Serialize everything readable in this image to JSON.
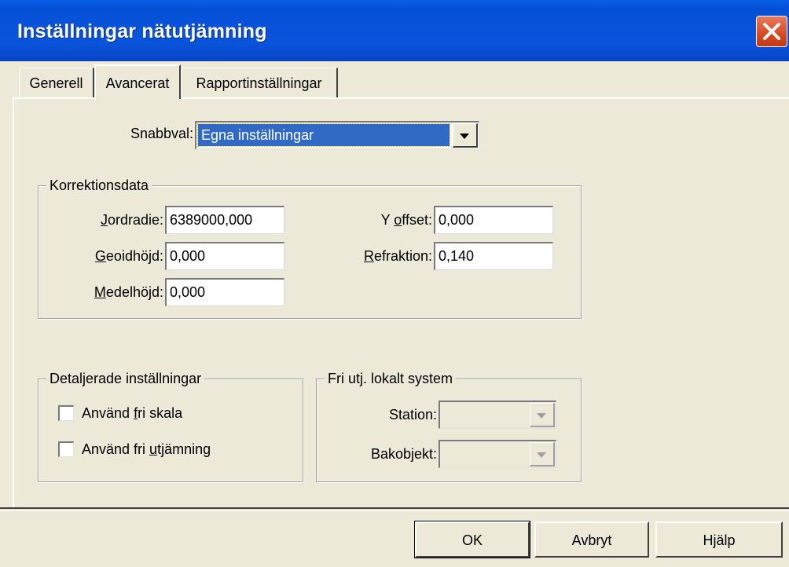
{
  "window": {
    "title": "Inställningar nätutjämning"
  },
  "tabs": [
    {
      "label": "Generell"
    },
    {
      "label": "Avancerat"
    },
    {
      "label": "Rapportinställningar"
    }
  ],
  "snabbval": {
    "label": "Snabbval:",
    "value": "Egna inställningar"
  },
  "korrektion": {
    "legend": "Korrektionsdata",
    "jordradie": {
      "label_u": "J",
      "label_rest": "ordradie:",
      "value": "6389000,000"
    },
    "geoidhojd": {
      "label_u": "G",
      "label_rest": "eoidhöjd:",
      "value": "0,000"
    },
    "medelhojd": {
      "label_u": "M",
      "label_rest": "edelhöjd:",
      "value": "0,000"
    },
    "y_offset": {
      "label_pre": "Y ",
      "label_u": "o",
      "label_rest": "ffset:",
      "value": "0,000"
    },
    "refraktion": {
      "label_u": "R",
      "label_rest": "efraktion:",
      "value": "0,140"
    }
  },
  "detaljerade": {
    "legend": "Detaljerade inställningar",
    "fri_skala": {
      "pre": "Använd ",
      "u": "f",
      "rest": "ri skala",
      "checked": false
    },
    "fri_utjamning": {
      "pre": "Använd fri ",
      "u": "u",
      "rest": "tjämning",
      "checked": false
    }
  },
  "fri_utj": {
    "legend": "Fri utj. lokalt system",
    "station_label": "Station:",
    "bakobjekt_label": "Bakobjekt:"
  },
  "buttons": {
    "ok": "OK",
    "cancel": "Avbryt",
    "help": "Hjälp"
  },
  "colors": {
    "titlebar": "#0a54dc",
    "selection": "#316ac5",
    "face": "#ece9d8",
    "close": "#d64a22"
  }
}
